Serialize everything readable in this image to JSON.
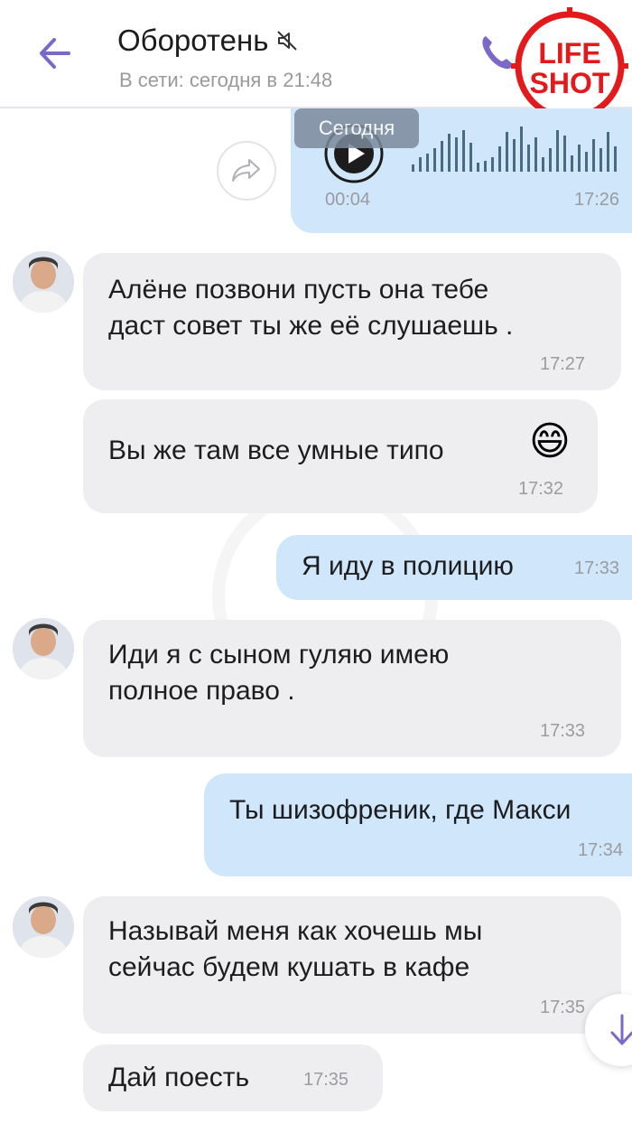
{
  "header": {
    "title": "Оборотень",
    "status": "В сети: сегодня в 21:48",
    "logo_line1": "LIFE",
    "logo_line2": "SHOT"
  },
  "date_chip": "Сегодня",
  "voice_message": {
    "duration": "00:04",
    "time": "17:26"
  },
  "messages": [
    {
      "direction": "in",
      "lines": [
        "Алёне позвони пусть она тебе",
        "даст совет ты же её слушаешь ."
      ],
      "time": "17:27"
    },
    {
      "direction": "in",
      "lines": [
        "Вы же там все умные типо"
      ],
      "emoji": "😄",
      "time": "17:32"
    },
    {
      "direction": "out",
      "lines": [
        "Я иду в полицию"
      ],
      "time": "17:33"
    },
    {
      "direction": "in",
      "lines": [
        "Иди я с сыном гуляю имею",
        "полное право ."
      ],
      "time": "17:33"
    },
    {
      "direction": "out",
      "lines": [
        "Ты шизофреник, где Макси"
      ],
      "time": "17:34"
    },
    {
      "direction": "in",
      "lines": [
        "Называй меня как хочешь мы",
        "сейчас будем кушать в кафе"
      ],
      "time": "17:35"
    },
    {
      "direction": "in",
      "lines": [
        "Дай поесть"
      ],
      "time": "17:35"
    }
  ],
  "colors": {
    "accent": "#7b68c8",
    "incoming_bubble": "#eeeef0",
    "outgoing_bubble": "#cfe6fb",
    "logo_red": "#e3191b"
  }
}
